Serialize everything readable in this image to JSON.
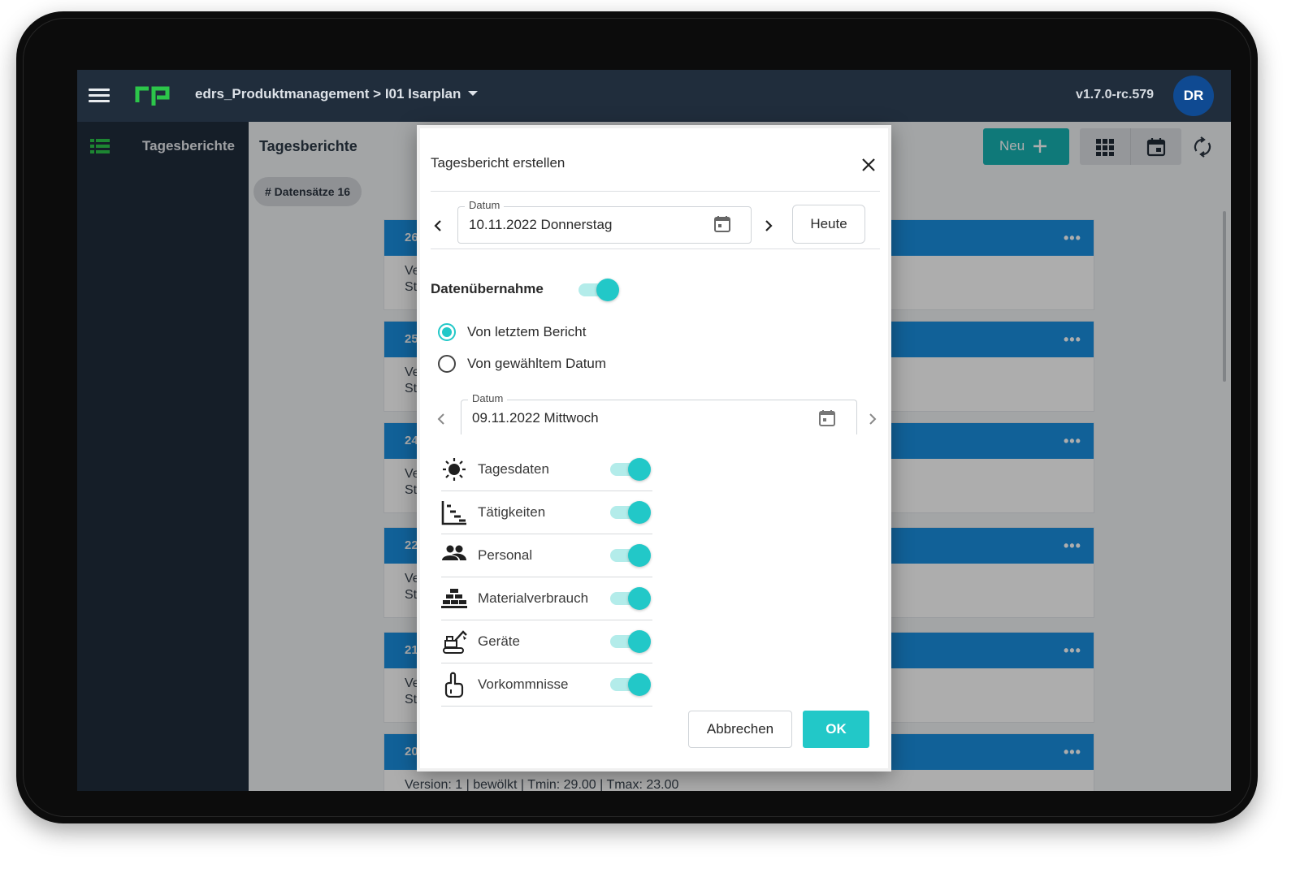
{
  "topbar": {
    "menu_icon": "hamburger-menu-icon",
    "logo_icon": "rp-logo-icon",
    "project_path": "edrs_Produktmanagement > I01 Isarplan",
    "version": "v1.7.0-rc.579",
    "avatar_initials": "DR"
  },
  "sidebar": {
    "items": [
      {
        "label": "Tagesberichte",
        "icon": "list-icon"
      }
    ]
  },
  "main": {
    "title": "Tagesberichte",
    "record_count_chip": "# Datensätze 16",
    "toolbar": {
      "new_label": "Neu",
      "new_icon": "plus-icon",
      "grid_icon": "grid-view-icon",
      "calendar_icon": "calendar-icon",
      "sync_icon": "sync-icon"
    },
    "cards": [
      {
        "number": "26",
        "line1": "Ve",
        "line2": "St"
      },
      {
        "number": "25",
        "line1": "Ve",
        "line2": "St"
      },
      {
        "number": "24",
        "line1": "Ve",
        "line2": "St"
      },
      {
        "number": "22",
        "line1": "Ve",
        "line2": "St"
      },
      {
        "number": "21",
        "line1": "Ve",
        "line2": "St"
      },
      {
        "number": "20",
        "line1": "Version: 1 | bewölkt | Tmin: 29.00 | Tmax: 23.00",
        "line2": ""
      }
    ],
    "more_icon": "more-horizontal-icon"
  },
  "dialog": {
    "title": "Tagesbericht erstellen",
    "close_icon": "close-icon",
    "date_label": "Datum",
    "date_value": "10.11.2022 Donnerstag",
    "today_label": "Heute",
    "transfer_label": "Datenübernahme",
    "transfer_enabled": true,
    "radio_options": [
      {
        "label": "Von letztem Bericht",
        "selected": true
      },
      {
        "label": "Von gewähltem Datum",
        "selected": false
      }
    ],
    "source_date_label": "Datum",
    "source_date_value": "09.11.2022 Mittwoch",
    "toggles": [
      {
        "label": "Tagesdaten",
        "icon": "sun-icon",
        "on": true
      },
      {
        "label": "Tätigkeiten",
        "icon": "activities-chart-icon",
        "on": true
      },
      {
        "label": "Personal",
        "icon": "people-icon",
        "on": true
      },
      {
        "label": "Materialverbrauch",
        "icon": "material-bricks-icon",
        "on": true
      },
      {
        "label": "Geräte",
        "icon": "excavator-icon",
        "on": true
      },
      {
        "label": "Vorkommnisse",
        "icon": "incident-hand-icon",
        "on": true
      }
    ],
    "cancel_label": "Abbrechen",
    "ok_label": "OK"
  },
  "colors": {
    "topbar_bg": "#202d3c",
    "card_header": "#1a8fe0",
    "accent_teal": "#22c8c8",
    "new_button": "#17b3b3",
    "logo_green": "#2cc64a"
  }
}
